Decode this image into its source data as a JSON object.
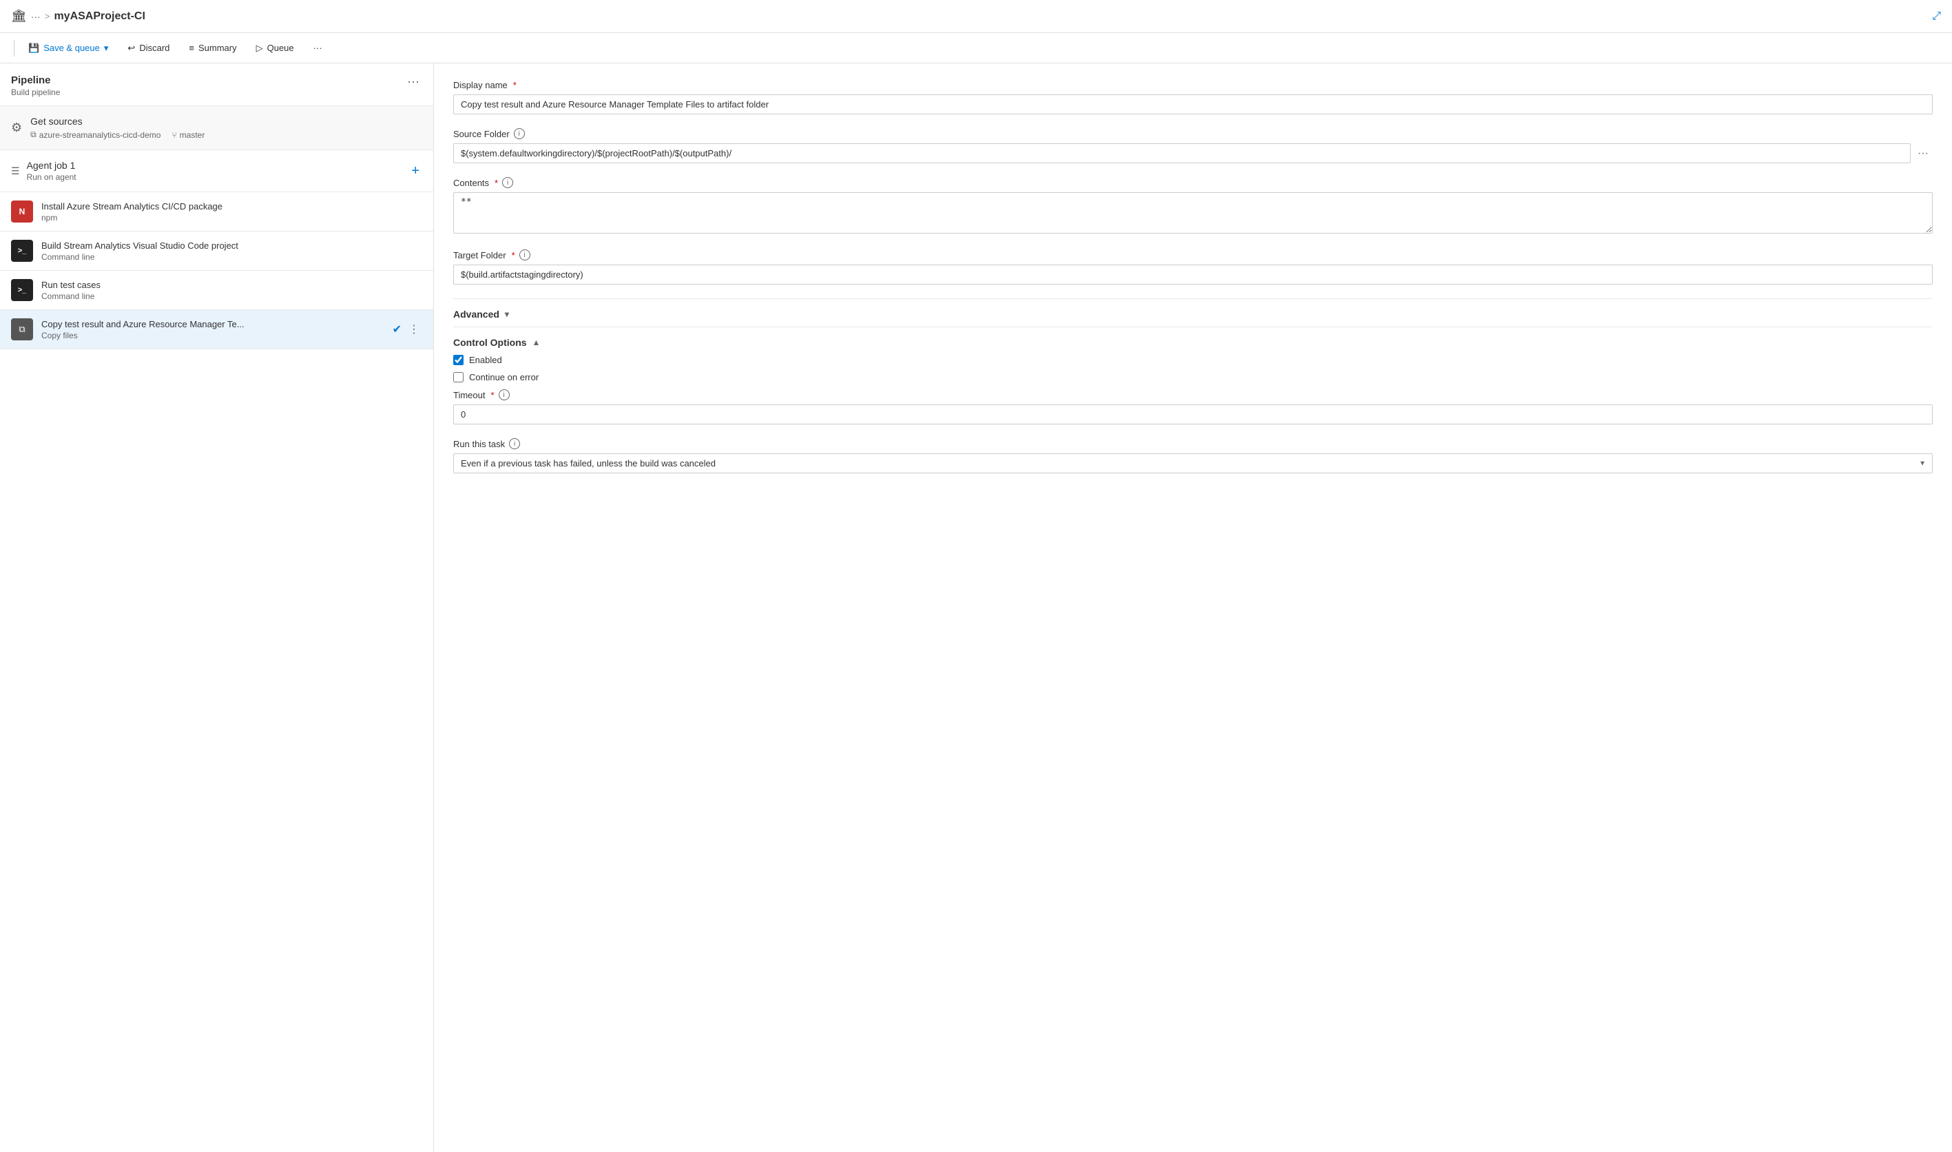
{
  "topbar": {
    "icon": "🏛",
    "dots": "···",
    "separator": ">",
    "title": "myASAProject-CI",
    "expand_icon": "⤢"
  },
  "toolbar": {
    "save_queue_label": "Save & queue",
    "discard_label": "Discard",
    "summary_label": "Summary",
    "queue_label": "Queue",
    "more_dots": "···"
  },
  "pipeline": {
    "title": "Pipeline",
    "subtitle": "Build pipeline",
    "more_dots": "···"
  },
  "get_sources": {
    "title": "Get sources",
    "repo": "azure-streamanalytics-cicd-demo",
    "branch": "master"
  },
  "agent_job": {
    "title": "Agent job 1",
    "subtitle": "Run on agent"
  },
  "tasks": [
    {
      "id": "install",
      "icon_type": "npm",
      "icon_text": "N",
      "title": "Install Azure Stream Analytics CI/CD package",
      "subtitle": "npm"
    },
    {
      "id": "build",
      "icon_type": "cmd",
      "icon_text": ">_",
      "title": "Build Stream Analytics Visual Studio Code project",
      "subtitle": "Command line"
    },
    {
      "id": "test",
      "icon_type": "cmd",
      "icon_text": ">_",
      "title": "Run test cases",
      "subtitle": "Command line"
    },
    {
      "id": "copy",
      "icon_type": "copy",
      "icon_text": "⧉",
      "title": "Copy test result and Azure Resource Manager Te...",
      "subtitle": "Copy files",
      "active": true
    }
  ],
  "right_panel": {
    "display_name_label": "Display name",
    "display_name_required": "*",
    "display_name_value": "Copy test result and Azure Resource Manager Template Files to artifact folder",
    "source_folder_label": "Source Folder",
    "source_folder_value": "$(system.defaultworkingdirectory)/$(projectRootPath)/$(outputPath)/",
    "contents_label": "Contents",
    "contents_required": "*",
    "contents_value": "**",
    "target_folder_label": "Target Folder",
    "target_folder_required": "*",
    "target_folder_value": "$(build.artifactstagingdirectory)",
    "advanced_label": "Advanced",
    "control_options_label": "Control Options",
    "enabled_label": "Enabled",
    "continue_on_error_label": "Continue on error",
    "timeout_label": "Timeout",
    "timeout_required": "*",
    "timeout_value": "0",
    "run_this_task_label": "Run this task",
    "run_this_task_value": "Even if a previous task has failed, unless the build was canceled"
  }
}
